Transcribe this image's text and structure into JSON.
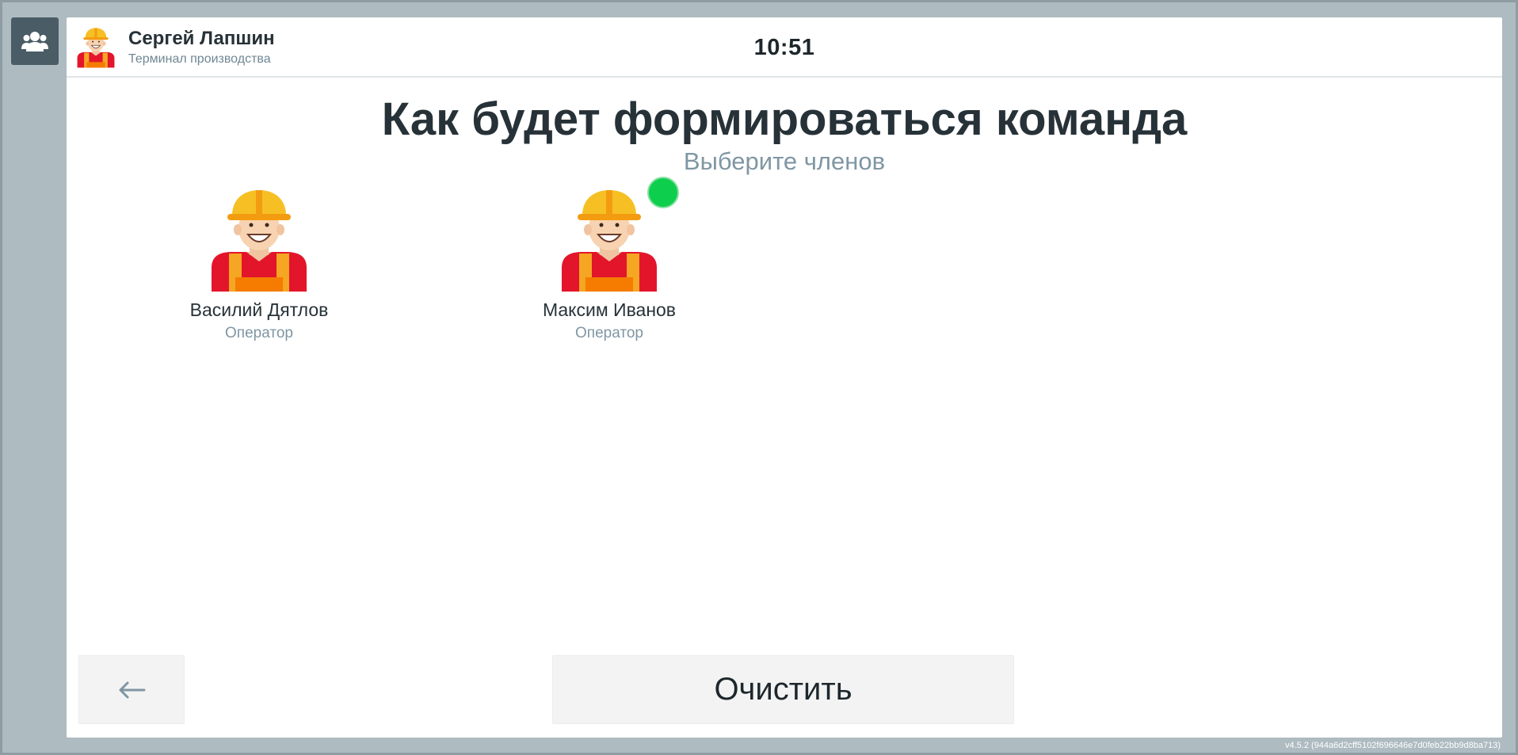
{
  "side_button": {
    "icon": "users-icon"
  },
  "header": {
    "user_name": "Сергей Лапшин",
    "user_role": "Терминал производства",
    "avatar_icon": "worker-avatar-icon",
    "time": "10:51"
  },
  "main": {
    "title": "Как будет формироваться команда",
    "subtitle": "Выберите членов",
    "status_indicator_color": "#0ecf4d",
    "workers": [
      {
        "name": "Василий Дятлов",
        "role": "Оператор",
        "avatar_icon": "worker-avatar-icon"
      },
      {
        "name": "Максим Иванов",
        "role": "Оператор",
        "avatar_icon": "worker-avatar-icon"
      }
    ]
  },
  "footer": {
    "back_icon": "arrow-left-icon",
    "clear_label": "Очистить"
  },
  "version": "v4.5.2 (944a6d2cff5102f696646e7d0feb22bb9d8ba713)",
  "colors": {
    "background": "#aebbc1",
    "side_button": "#4a5c66",
    "title_text": "#273238",
    "muted_text": "#7f96a3",
    "button_bg": "#f3f3f3"
  }
}
